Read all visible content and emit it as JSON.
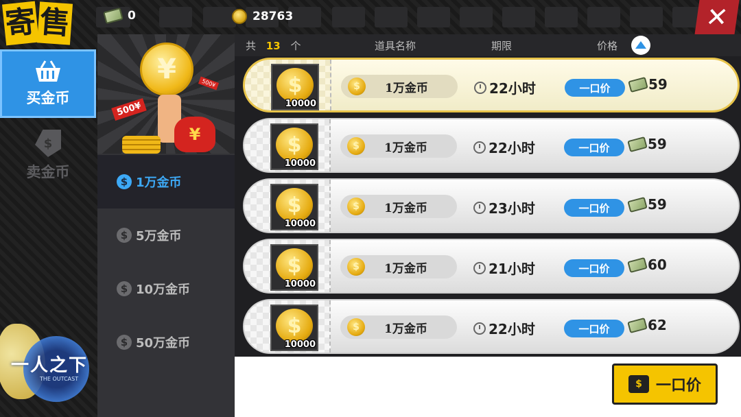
{
  "title": {
    "chars": [
      "寄",
      "售"
    ]
  },
  "game_logo": {
    "title": "一人之下",
    "subtitle": "THE OUTCAST"
  },
  "topbar": {
    "cash_value": "0",
    "coin_value": "28763"
  },
  "nav": {
    "buy_label": "买金币",
    "sell_label": "卖金币"
  },
  "banner": {
    "coin_glyph": "¥",
    "bag_glyph": "¥",
    "tag_500": "500¥",
    "tag_500b": "500¥"
  },
  "categories": [
    {
      "label": "1万金币",
      "active": true
    },
    {
      "label": "5万金币",
      "active": false
    },
    {
      "label": "10万金币",
      "active": false
    },
    {
      "label": "50万金币",
      "active": false
    }
  ],
  "list_header": {
    "total_prefix": "共",
    "total_count": "13",
    "total_suffix": "个",
    "col_name": "道具名称",
    "col_period": "期限",
    "col_price": "价格"
  },
  "rows": [
    {
      "qty": "10000",
      "name": "1万金币",
      "time": "22小时",
      "buy_label": "一口价",
      "price": "59",
      "selected": true
    },
    {
      "qty": "10000",
      "name": "1万金币",
      "time": "22小时",
      "buy_label": "一口价",
      "price": "59",
      "selected": false
    },
    {
      "qty": "10000",
      "name": "1万金币",
      "time": "23小时",
      "buy_label": "一口价",
      "price": "59",
      "selected": false
    },
    {
      "qty": "10000",
      "name": "1万金币",
      "time": "21小时",
      "buy_label": "一口价",
      "price": "60",
      "selected": false
    },
    {
      "qty": "10000",
      "name": "1万金币",
      "time": "22小时",
      "buy_label": "一口价",
      "price": "62",
      "selected": false
    }
  ],
  "main_buy_label": "一口价",
  "colors": {
    "accent_blue": "#2f93e5",
    "accent_yellow": "#f5c400",
    "close_red": "#b3232a"
  },
  "icons": {
    "cash": "cash-bundle-icon",
    "coin": "gold-coin-icon",
    "close": "close-icon",
    "basket": "basket-icon",
    "tag": "price-tag-icon",
    "clock": "clock-icon",
    "sort": "sort-up-icon",
    "hand": "deal-hand-icon"
  }
}
